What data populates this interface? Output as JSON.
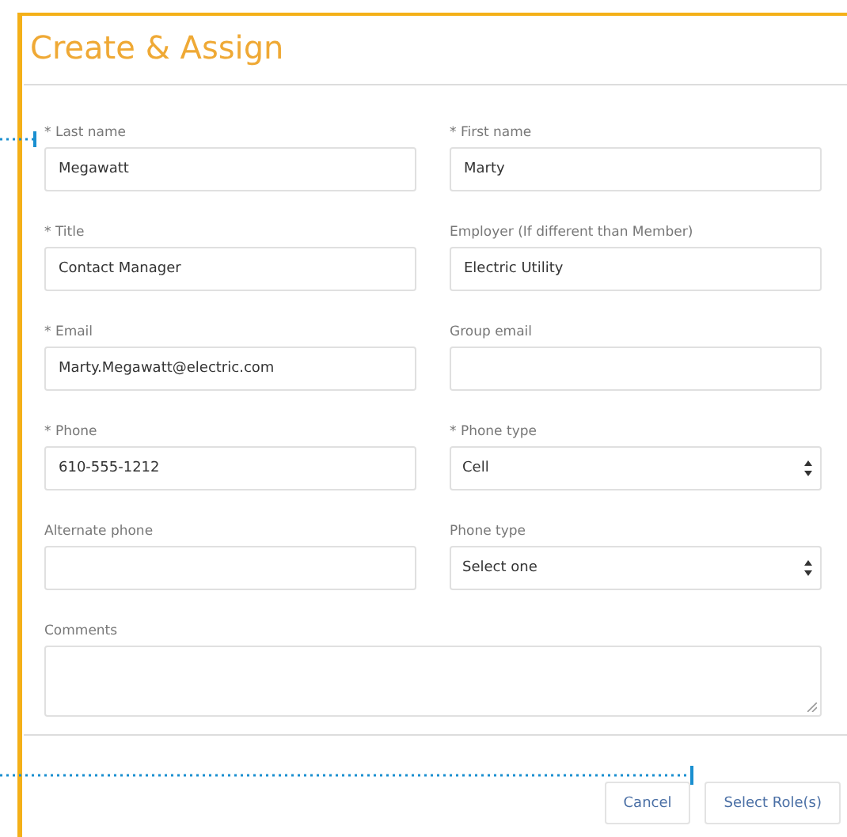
{
  "dialog": {
    "title": "Create & Assign"
  },
  "fields": [
    {
      "kind": "text",
      "label": "* Last name",
      "value": "Megawatt"
    },
    {
      "kind": "text",
      "label": "* First name",
      "value": "Marty"
    },
    {
      "kind": "text",
      "label": "* Title",
      "value": "Contact Manager"
    },
    {
      "kind": "text",
      "label": "Employer (If different than Member)",
      "value": "Electric Utility"
    },
    {
      "kind": "text",
      "label": "* Email",
      "value": "Marty.Megawatt@electric.com"
    },
    {
      "kind": "text",
      "label": "Group email"
    },
    {
      "kind": "text",
      "label": "* Phone",
      "value": "610-555-1212"
    },
    {
      "kind": "select",
      "label": "* Phone type",
      "value": "Cell"
    },
    {
      "kind": "text",
      "label": "Alternate phone"
    },
    {
      "kind": "select",
      "label": "Phone type",
      "value": "Select one"
    },
    {
      "kind": "textarea",
      "label": "Comments"
    }
  ],
  "buttons": [
    "Cancel",
    "Select Role(s)"
  ]
}
